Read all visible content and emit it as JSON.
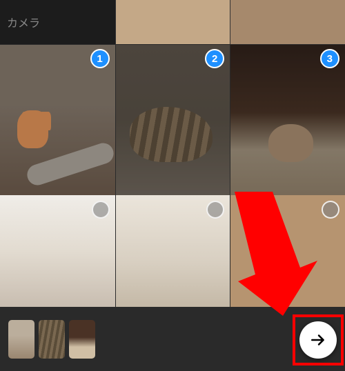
{
  "header": {
    "camera_label": "カメラ"
  },
  "photos": {
    "row1": [
      {
        "name": "cat-kitten-branch",
        "selected_index": "1"
      },
      {
        "name": "cat-sleeping-tabby",
        "selected_index": "2"
      },
      {
        "name": "cat-under-blanket",
        "selected_index": "3"
      }
    ],
    "row2": [
      {
        "name": "photo-light-1",
        "selected": false
      },
      {
        "name": "photo-light-2",
        "selected": false
      },
      {
        "name": "photo-tan",
        "selected": false
      }
    ]
  },
  "tray": {
    "thumbnails": [
      {
        "ref": "cat-kitten-branch"
      },
      {
        "ref": "cat-sleeping-tabby"
      },
      {
        "ref": "cat-under-blanket"
      }
    ]
  },
  "colors": {
    "selection_badge": "#1e90ff",
    "annotation": "#ff0000"
  }
}
